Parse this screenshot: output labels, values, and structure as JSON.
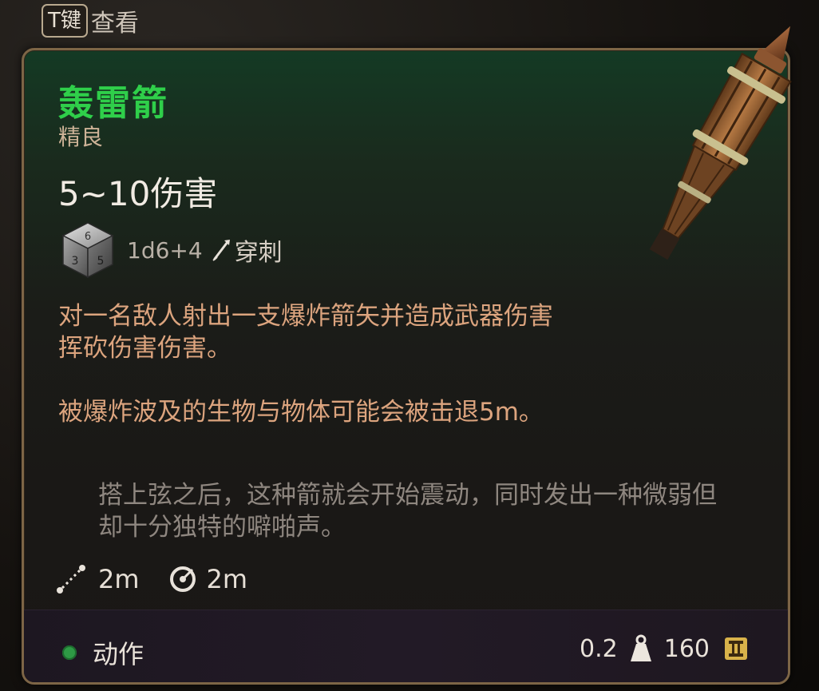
{
  "hint": {
    "key": "T键",
    "label": "查看"
  },
  "item": {
    "name": "轰雷箭",
    "rarity": "精良",
    "damage": "5~10伤害",
    "dice": "1d6+4",
    "damage_type": "穿刺",
    "description_1": "对一名敌人射出一支爆炸箭矢并造成武器伤害挥砍伤害伤害。",
    "description_2": "被爆炸波及的生物与物体可能会被击退5m。",
    "flavor": "搭上弦之后，这种箭就会开始震动，同时发出一种微弱但却十分独特的噼啪声。",
    "range": "2m",
    "radius": "2m"
  },
  "footer": {
    "action": "动作",
    "weight": "0.2",
    "price": "160"
  },
  "icons": {
    "dice": "d6-dice-icon",
    "pierce": "piercing-arrow-icon",
    "range": "range-dotted-line-icon",
    "radius": "aoe-radius-icon",
    "weight": "weight-icon",
    "gold": "gold-coin-icon",
    "action": "action-dot-icon"
  },
  "colors": {
    "title": "#2fcf4a",
    "description": "#dca47e",
    "flavor": "#8f8780",
    "border": "#7d6546",
    "action_dot": "#2e9a45",
    "gold": "#d8b24a"
  }
}
